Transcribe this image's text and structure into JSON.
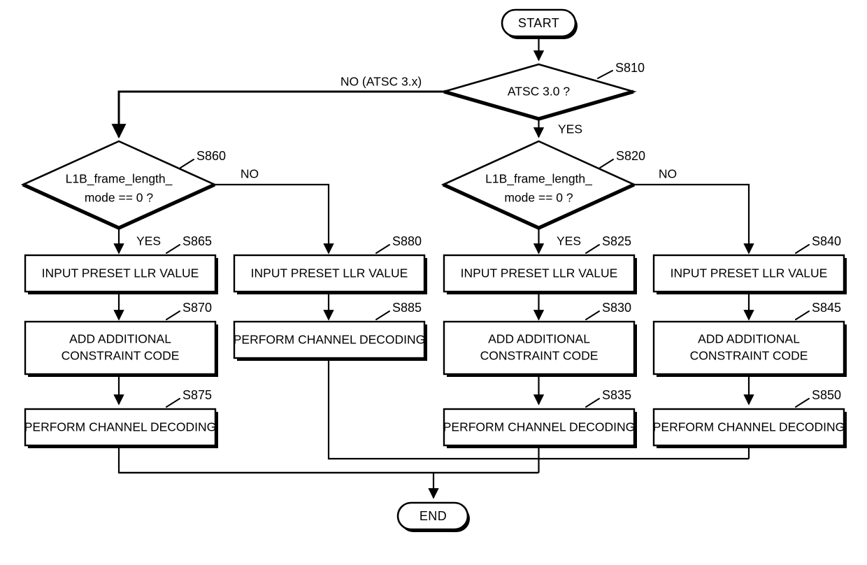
{
  "diagram": {
    "title": "ATSC channel decoding flowchart",
    "type": "flowchart",
    "terminators": {
      "start": "START",
      "end": "END"
    },
    "decisions": [
      {
        "id": "S810",
        "ref": "S810",
        "text_line1": "ATSC 3.0 ?",
        "text_line2": "",
        "yes_label": "YES",
        "no_label": "NO (ATSC 3.x)"
      },
      {
        "id": "S860",
        "ref": "S860",
        "text_line1": "L1B_frame_length_",
        "text_line2": "mode == 0 ?",
        "yes_label": "YES",
        "no_label": "NO"
      },
      {
        "id": "S820",
        "ref": "S820",
        "text_line1": "L1B_frame_length_",
        "text_line2": "mode == 0 ?",
        "yes_label": "YES",
        "no_label": "NO"
      }
    ],
    "processes": [
      {
        "id": "S865",
        "ref": "S865",
        "line1": "INPUT PRESET LLR VALUE",
        "line2": ""
      },
      {
        "id": "S870",
        "ref": "S870",
        "line1": "ADD ADDITIONAL",
        "line2": "CONSTRAINT CODE"
      },
      {
        "id": "S875",
        "ref": "S875",
        "line1": "PERFORM CHANNEL DECODING",
        "line2": ""
      },
      {
        "id": "S880",
        "ref": "S880",
        "line1": "INPUT PRESET LLR VALUE",
        "line2": ""
      },
      {
        "id": "S885",
        "ref": "S885",
        "line1": "PERFORM CHANNEL DECODING",
        "line2": ""
      },
      {
        "id": "S825",
        "ref": "S825",
        "line1": "INPUT PRESET LLR VALUE",
        "line2": ""
      },
      {
        "id": "S830",
        "ref": "S830",
        "line1": "ADD ADDITIONAL",
        "line2": "CONSTRAINT CODE"
      },
      {
        "id": "S835",
        "ref": "S835",
        "line1": "PERFORM CHANNEL DECODING",
        "line2": ""
      },
      {
        "id": "S840",
        "ref": "S840",
        "line1": "INPUT PRESET LLR VALUE",
        "line2": ""
      },
      {
        "id": "S845",
        "ref": "S845",
        "line1": "ADD ADDITIONAL",
        "line2": "CONSTRAINT CODE"
      },
      {
        "id": "S850",
        "ref": "S850",
        "line1": "PERFORM CHANNEL DECODING",
        "line2": ""
      }
    ],
    "colors": {
      "line": "#000000",
      "fill": "#ffffff",
      "background": "#ffffff"
    }
  }
}
